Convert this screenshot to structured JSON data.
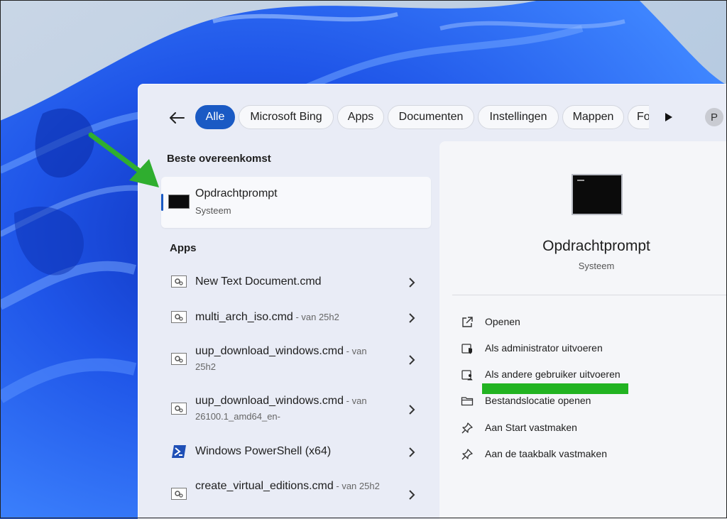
{
  "filters": {
    "back_label": "Terug",
    "chips": [
      "Alle",
      "Microsoft Bing",
      "Apps",
      "Documenten",
      "Instellingen",
      "Mappen",
      "Fo"
    ],
    "avatar_initial": "P"
  },
  "best_match": {
    "heading": "Beste overeenkomst",
    "title": "Opdrachtprompt",
    "subtitle": "Systeem"
  },
  "apps": {
    "heading": "Apps",
    "items": [
      {
        "name": "New Text Document.cmd",
        "suffix": "",
        "icon": "cmd-file-icon"
      },
      {
        "name": "multi_arch_iso.cmd",
        "suffix": " - van 25h2",
        "icon": "cmd-file-icon"
      },
      {
        "name": "uup_download_windows.cmd",
        "suffix": " - van 25h2",
        "icon": "cmd-file-icon"
      },
      {
        "name": "uup_download_windows.cmd",
        "suffix": " - van 26100.1_amd64_en-",
        "icon": "cmd-file-icon"
      },
      {
        "name": "Windows PowerShell (x64)",
        "suffix": "",
        "icon": "powershell-icon"
      },
      {
        "name": "create_virtual_editions.cmd",
        "suffix": " - van 25h2",
        "icon": "cmd-file-icon"
      }
    ]
  },
  "detail": {
    "title": "Opdrachtprompt",
    "subtitle": "Systeem",
    "actions": [
      {
        "label": "Openen",
        "icon": "open-external-icon"
      },
      {
        "label": "Als administrator uitvoeren",
        "icon": "shield-icon"
      },
      {
        "label": "Als andere gebruiker uitvoeren",
        "icon": "user-shield-icon"
      },
      {
        "label": "Bestandslocatie openen",
        "icon": "folder-icon"
      },
      {
        "label": "Aan Start vastmaken",
        "icon": "pin-icon"
      },
      {
        "label": "Aan de taakbalk vastmaken",
        "icon": "pin-icon"
      }
    ]
  },
  "colors": {
    "accent": "#1a5ac4",
    "highlight": "#22b321",
    "annotation_arrow": "#2fae2f"
  }
}
